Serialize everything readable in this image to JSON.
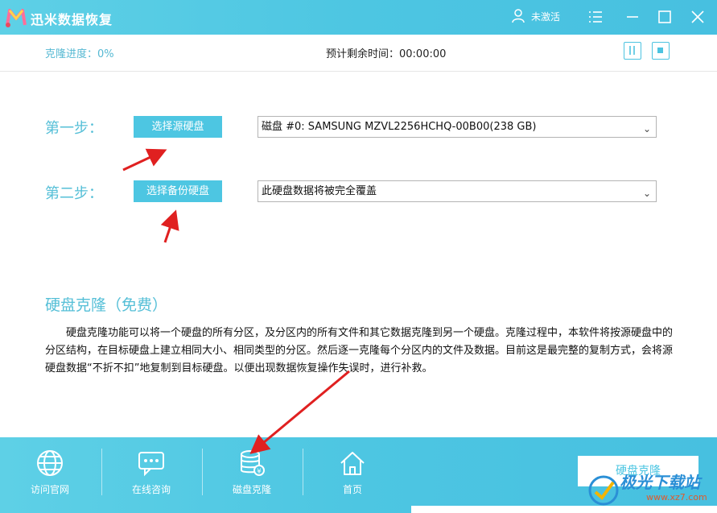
{
  "app": {
    "title": "迅米数据恢复",
    "user_label": "未激活"
  },
  "progress": {
    "label": "克隆进度：0%",
    "remaining": "预计剩余时间：00:00:00"
  },
  "step1": {
    "label": "第一步：",
    "button": "选择源硬盘",
    "selected": "磁盘 #0: SAMSUNG MZVL2256HCHQ-00B00(238 GB)"
  },
  "step2": {
    "label": "第二步：",
    "button": "选择备份硬盘",
    "selected": "此硬盘数据将被完全覆盖"
  },
  "section": {
    "title": "硬盘克隆（免费）",
    "description": "硬盘克隆功能可以将一个硬盘的所有分区，及分区内的所有文件和其它数据克隆到另一个硬盘。克隆过程中，本软件将按源硬盘中的分区结构，在目标硬盘上建立相同大小、相同类型的分区。然后逐一克隆每个分区内的文件及数据。目前这是最完整的复制方式，会将源硬盘数据“不折不扣”地复制到目标硬盘。以便出现数据恢复操作失误时，进行补救。"
  },
  "bottom_nav": [
    {
      "label": "访问官网",
      "icon": "globe-icon"
    },
    {
      "label": "在线咨询",
      "icon": "chat-icon"
    },
    {
      "label": "磁盘克隆",
      "icon": "disk-clone-icon"
    },
    {
      "label": "首页",
      "icon": "home-icon"
    }
  ],
  "clone_button": "硬盘克隆",
  "watermark": {
    "name": "极光下载站",
    "url": "www.xz7.com"
  },
  "colors": {
    "accent": "#4dc6e2",
    "step_text": "#55bfd7",
    "arrow": "#e02020"
  }
}
